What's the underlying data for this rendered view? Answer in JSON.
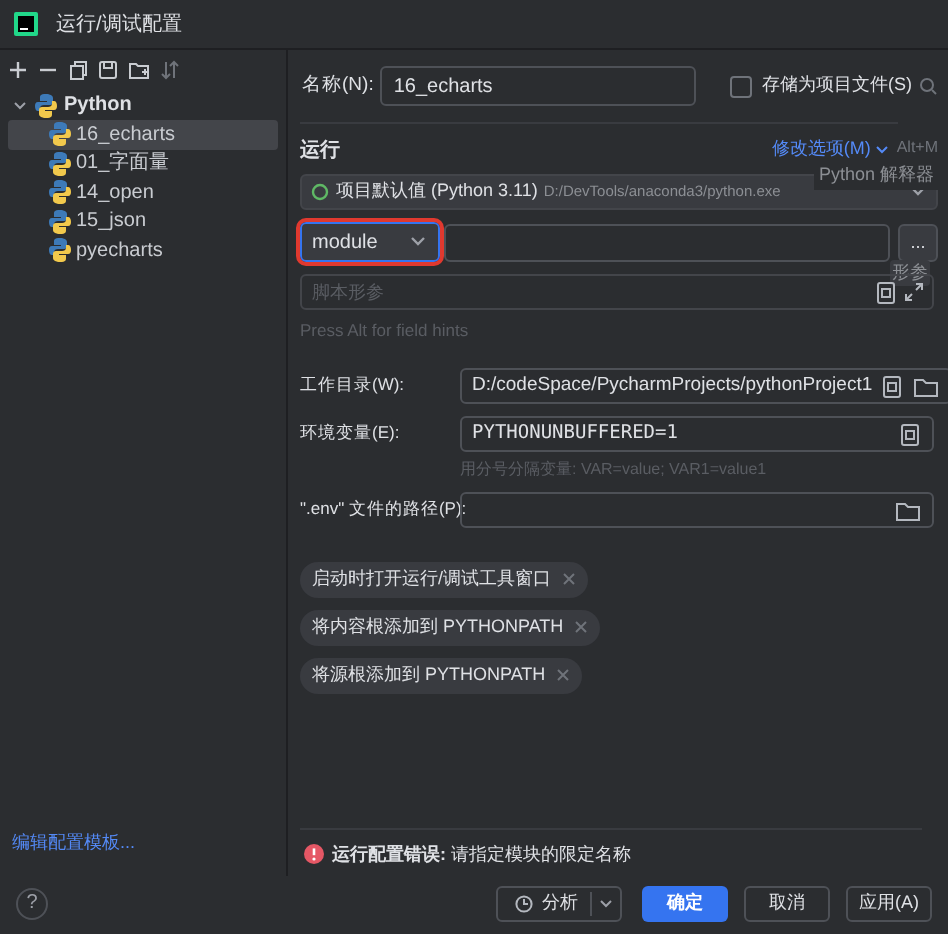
{
  "window": {
    "title": "运行/调试配置"
  },
  "tree": [
    {
      "label": "Python",
      "expanded": true,
      "selected": false,
      "children": [
        {
          "label": "16_echarts",
          "selected": true
        },
        {
          "label": "01_字面量",
          "selected": false
        },
        {
          "label": "14_open",
          "selected": false
        },
        {
          "label": "15_json",
          "selected": false
        },
        {
          "label": "pyecharts",
          "selected": false
        }
      ]
    }
  ],
  "edit_templates_link": "编辑配置模板...",
  "name": {
    "label": "名称(N):",
    "value": "16_echarts"
  },
  "store_as_project_file": {
    "label": "存储为项目文件(S)",
    "checked": false
  },
  "run_section": {
    "title": "运行",
    "modify_options": "修改选项(M)",
    "shortcut": "Alt+M",
    "tooltip": "Python 解释器"
  },
  "interpreter": {
    "name": "项目默认值 (Python 3.11)",
    "path": "D:/DevTools/anaconda3/python.exe"
  },
  "target": {
    "type": "module",
    "error": true,
    "button": "...",
    "button_hint": "形参"
  },
  "script_params": {
    "placeholder": "脚本形参"
  },
  "hint": "Press Alt for field hints",
  "working_dir": {
    "label": "工作目录(W):",
    "value": "D:/codeSpace/PycharmProjects/pythonProject1"
  },
  "env_vars": {
    "label": "环境变量(E):",
    "value": "PYTHONUNBUFFERED=1",
    "hint": "用分号分隔变量: VAR=value; VAR1=value1"
  },
  "env_file": {
    "label": "\".env\" 文件的路径(P):"
  },
  "tags": [
    {
      "label": "启动时打开运行/调试工具窗口"
    },
    {
      "label": "将内容根添加到 PYTHONPATH"
    },
    {
      "label": "将源根添加到 PYTHONPATH"
    }
  ],
  "error": {
    "title": "运行配置错误:",
    "message": "请指定模块的限定名称"
  },
  "help": "?",
  "buttons": [
    {
      "label": "分析",
      "kind": "split"
    },
    {
      "label": "确定",
      "kind": "primary"
    },
    {
      "label": "取消",
      "kind": "normal"
    },
    {
      "label": "应用(A)",
      "kind": "normal"
    }
  ]
}
